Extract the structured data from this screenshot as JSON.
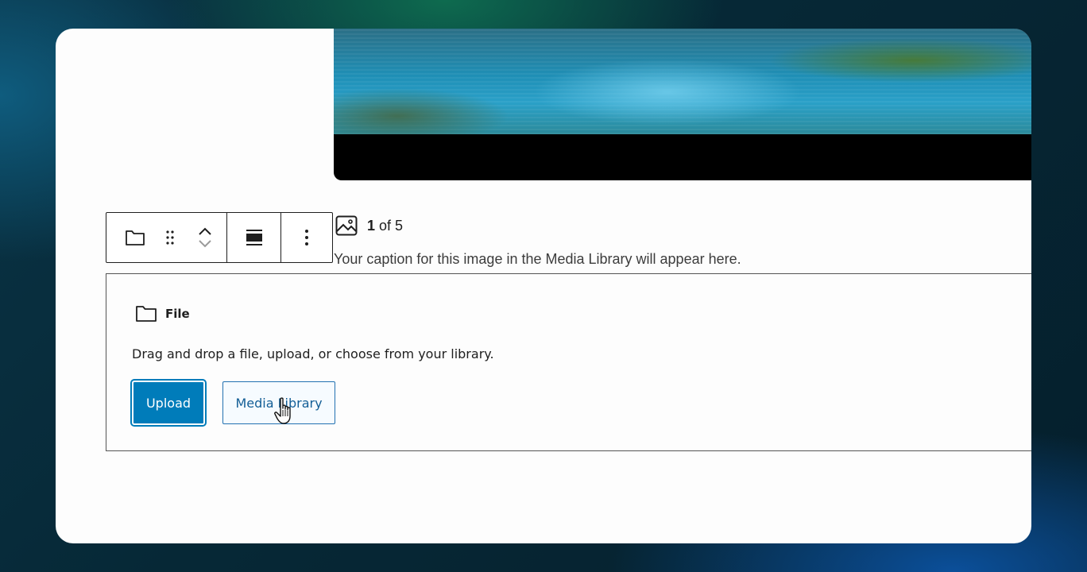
{
  "gallery": {
    "counter_current": "1",
    "counter_rest": "of 5",
    "caption": "Your caption for this image in the Media Library will appear here."
  },
  "toolbar": {
    "icons": [
      "folder-icon",
      "drag-handle-icon",
      "chevron-up-icon",
      "chevron-down-icon",
      "align-icon",
      "more-options-icon"
    ]
  },
  "file_block": {
    "title": "File",
    "instructions": "Drag and drop a file, upload, or choose from your library.",
    "upload_label": "Upload",
    "media_library_label": "Media Library"
  },
  "colors": {
    "primary": "#007cba",
    "secondary_text": "#135e96",
    "border": "#1e1e1e"
  }
}
